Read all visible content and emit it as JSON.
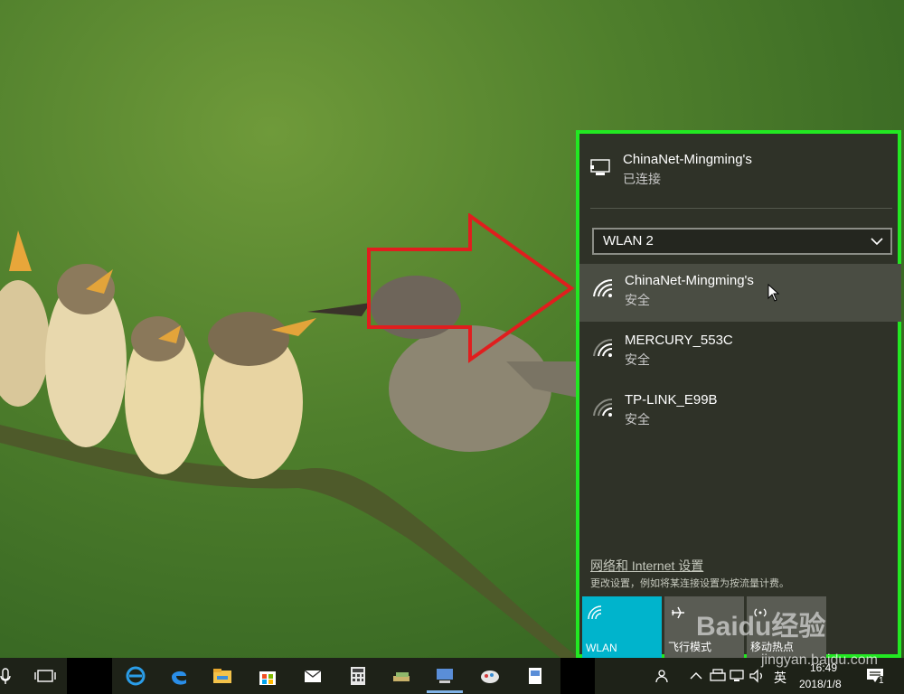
{
  "flyout": {
    "connected": {
      "name": "ChinaNet-Mingming's",
      "status": "已连接"
    },
    "adapter": "WLAN 2",
    "networks": [
      {
        "ssid": "ChinaNet-Mingming's",
        "security": "安全"
      },
      {
        "ssid": "MERCURY_553C",
        "security": "安全"
      },
      {
        "ssid": "TP-LINK_E99B",
        "security": "安全"
      }
    ],
    "settings_link": "网络和 Internet 设置",
    "settings_note": "更改设置，例如将某连接设置为按流量计费。",
    "quick_actions": [
      {
        "label": "WLAN",
        "icon": "wifi-icon",
        "active": true
      },
      {
        "label": "飞行模式",
        "icon": "airplane-icon",
        "active": false
      },
      {
        "label": "移动热点",
        "icon": "hotspot-icon",
        "active": false
      }
    ]
  },
  "taskbar": {
    "ime": "英",
    "time": "16:49",
    "date": "2018/1/8",
    "notification_count": "1"
  },
  "watermark": {
    "brand": "Baidu经验",
    "site": "jingyan.baidu.com"
  },
  "colors": {
    "highlight_border": "#22e822",
    "arrow": "#e01e1e",
    "wlan_tile": "#00b4cc"
  }
}
